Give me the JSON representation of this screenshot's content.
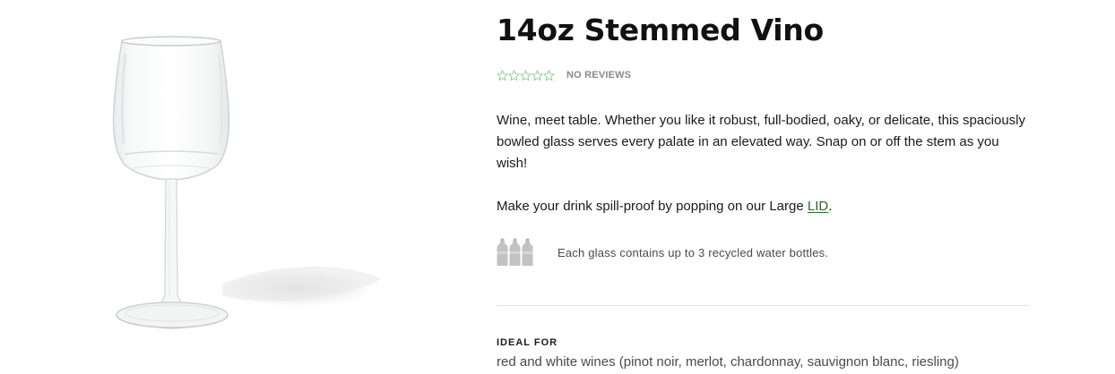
{
  "product": {
    "title": "14oz Stemmed Vino",
    "rating": {
      "stars": 0,
      "max_stars": 5,
      "reviews_label": "NO REVIEWS",
      "star_color": "#7fc98a"
    },
    "description": "Wine, meet table. Whether you like it robust, full-bodied, oaky, or delicate, this spaciously bowled glass serves every palate in an elevated way. Snap on or off the stem as you wish!",
    "lid_prefix": "Make your drink spill-proof by popping on our Large ",
    "lid_link": "LID",
    "lid_suffix": ".",
    "recycled": {
      "bottle_count": 3,
      "text": "Each glass contains up to 3 recycled water bottles."
    },
    "ideal_for": {
      "heading": "IDEAL FOR",
      "text": "red and white wines (pinot noir, merlot, chardonnay, sauvignon blanc, riesling)"
    },
    "image": {
      "icon": "wine-glass-image"
    }
  },
  "colors": {
    "link": "#2b6b2b",
    "muted_text": "#8a8a8a",
    "divider": "#e4e4e4"
  }
}
